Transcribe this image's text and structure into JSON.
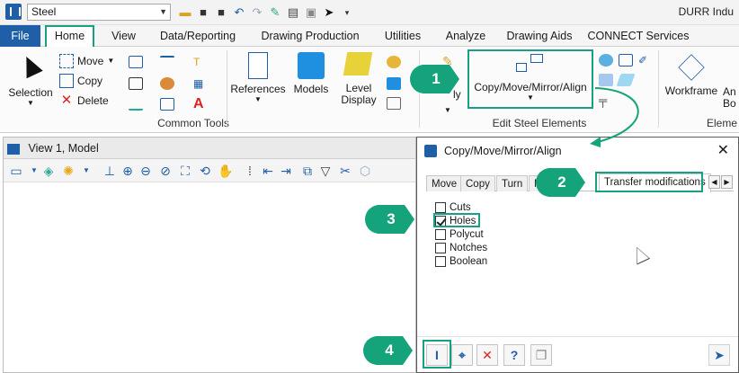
{
  "titlebar": {
    "workspace": "Steel",
    "company": "DURR Indu"
  },
  "tabs": [
    "File",
    "Home",
    "View",
    "Data/Reporting",
    "Drawing Production",
    "Utilities",
    "Analyze",
    "Drawing Aids",
    "CONNECT Services"
  ],
  "ribbon": {
    "selection_label": "Selection",
    "move_label": "Move",
    "copy_label": "Copy",
    "delete_label": "Delete",
    "common_tools_label": "Common Tools",
    "references_label": "References",
    "models_label": "Models",
    "level_display_label": "Level Display",
    "copy_move_label": "Copy/Move/Mirror/Align",
    "edit_steel_label": "Edit Steel Elements",
    "workframe_label": "Workframe",
    "angle_label": "An Bo",
    "element_label": "Eleme",
    "ply_label": "ly"
  },
  "view": {
    "title": "View 1, Model"
  },
  "dialog": {
    "title": "Copy/Move/Mirror/Align",
    "tabs": [
      "Move",
      "Copy",
      "Turn",
      "M",
      "Transfer modifications"
    ],
    "checkboxes": [
      {
        "label": "Cuts",
        "checked": false
      },
      {
        "label": "Holes",
        "checked": true
      },
      {
        "label": "Polycut",
        "checked": false
      },
      {
        "label": "Notches",
        "checked": false
      },
      {
        "label": "Boolean",
        "checked": false
      }
    ],
    "bottom_buttons": [
      "profile-icon",
      "fit-icon",
      "cancel-icon",
      "help-icon",
      "copy-doc-icon"
    ],
    "help_glyph": "?"
  },
  "callouts": [
    "1",
    "2",
    "3",
    "4"
  ],
  "colors": {
    "accent": "#18a086",
    "badge": "#14a37a",
    "brand": "#1f5fa8"
  }
}
